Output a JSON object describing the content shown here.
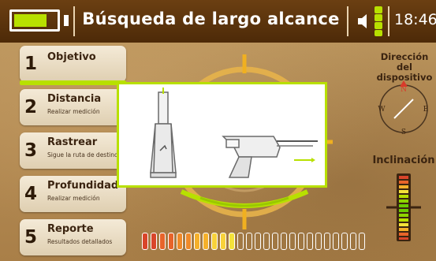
{
  "header": {
    "title": "Búsqueda de largo alcance",
    "time": "18:46",
    "battery_level": 0.78,
    "signal_level": 1.0,
    "colors": {
      "bar": "#5a3410",
      "accent": "#b8e000"
    }
  },
  "menu": {
    "active_index": 0,
    "items": [
      {
        "number": "1",
        "label": "Objetivo",
        "sub": ""
      },
      {
        "number": "2",
        "label": "Distancia",
        "sub": "Realizar medición"
      },
      {
        "number": "3",
        "label": "Rastrear",
        "sub": "Sigue la ruta de destino"
      },
      {
        "number": "4",
        "label": "Profundidad",
        "sub": "Realizar medición"
      },
      {
        "number": "5",
        "label": "Reporte",
        "sub": "Resultados detallados"
      }
    ]
  },
  "right_panel": {
    "direction_label_line1": "Dirección",
    "direction_label_line2": "del dispositivo",
    "compass": {
      "n": "N",
      "e": "E",
      "s": "S",
      "w": "W"
    },
    "inclination_label": "Inclinación"
  },
  "signal_meter": {
    "total_segments": 26,
    "filled_segments": 11,
    "colors": [
      "#d9452a",
      "#e8642a",
      "#f08a2a",
      "#f5b02a",
      "#f8d23a",
      "#f4e23a"
    ]
  },
  "icons": {
    "speaker": "speaker-icon",
    "signal": "signal-strength-icon",
    "battery": "battery-icon"
  }
}
